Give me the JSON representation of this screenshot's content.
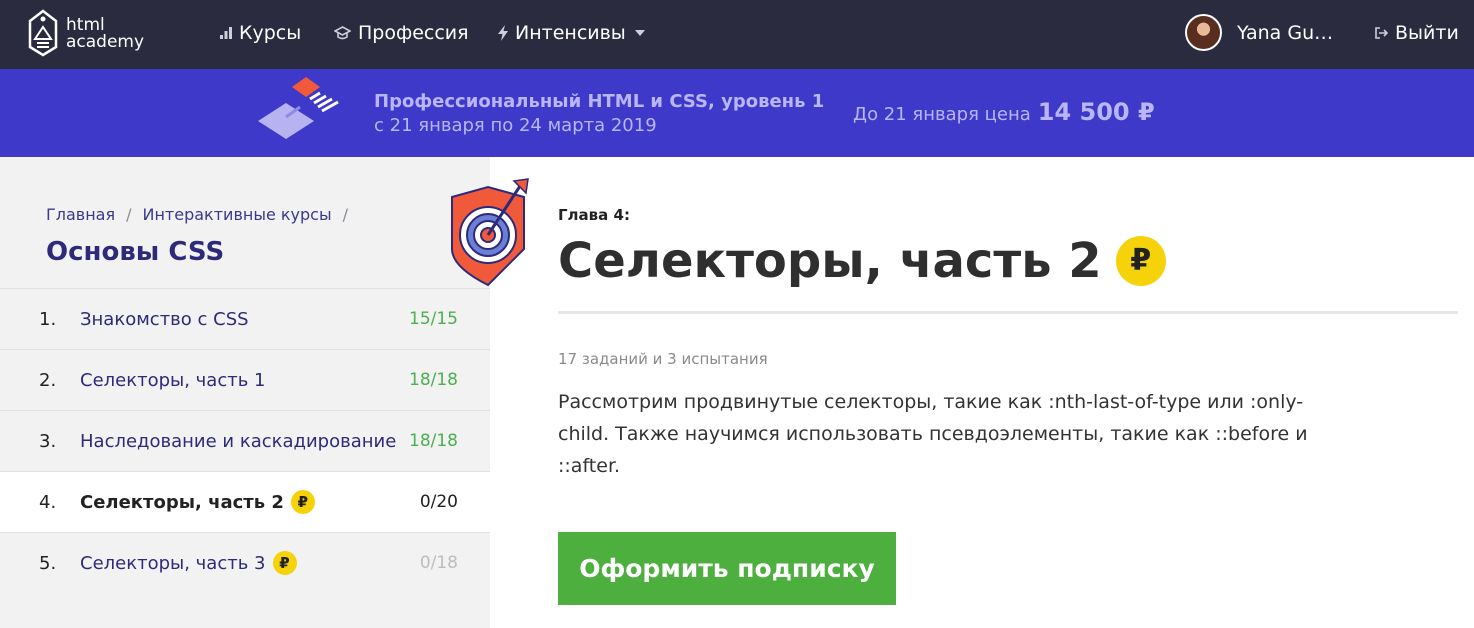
{
  "header": {
    "logo_line1": "html",
    "logo_line2": "academy",
    "nav": [
      {
        "label": "Курсы",
        "icon": "bars-icon"
      },
      {
        "label": "Профессия",
        "icon": "graduation-cap-icon"
      },
      {
        "label": "Интенсивы",
        "icon": "lightning-icon"
      }
    ],
    "username": "Yana Gus...",
    "logout_label": "Выйти"
  },
  "promo": {
    "title": "Профессиональный HTML и CSS, уровень 1",
    "dates": "с 21 января по 24 марта 2019",
    "price_prefix": "До 21 января цена",
    "price": "14 500 ₽"
  },
  "sidebar": {
    "breadcrumbs": [
      "Главная",
      "Интерактивные курсы"
    ],
    "breadcrumb_separator": "/",
    "course_title": "Основы CSS",
    "chapters": [
      {
        "num": "1.",
        "name": "Знакомство с CSS",
        "progress": "15/15",
        "paid": false
      },
      {
        "num": "2.",
        "name": "Селекторы, часть 1",
        "progress": "18/18",
        "paid": false
      },
      {
        "num": "3.",
        "name": "Наследование и каскадирование",
        "progress": "18/18",
        "paid": false
      },
      {
        "num": "4.",
        "name": "Селекторы, часть 2",
        "progress": "0/20",
        "paid": true,
        "active": true
      },
      {
        "num": "5.",
        "name": "Селекторы, часть 3",
        "progress": "0/18",
        "paid": true
      }
    ],
    "ruble_symbol": "₽"
  },
  "main": {
    "chapter_label": "Глава 4:",
    "title": "Селекторы, часть 2",
    "ruble_symbol": "₽",
    "tasks": "17 заданий и 3 испытания",
    "description": "Рассмотрим продвинутые селекторы, такие как :nth-last-of-type или :only-child. Также научимся использовать псевдоэлементы, такие как ::before и ::after.",
    "subscribe_label": "Оформить подписку"
  },
  "colors": {
    "header_bg": "#2b2b3f",
    "promo_bg": "#3e39c9",
    "accent_green": "#4caf3e",
    "ruble_yellow": "#f5d20a",
    "course_title": "#2e2a7a"
  }
}
